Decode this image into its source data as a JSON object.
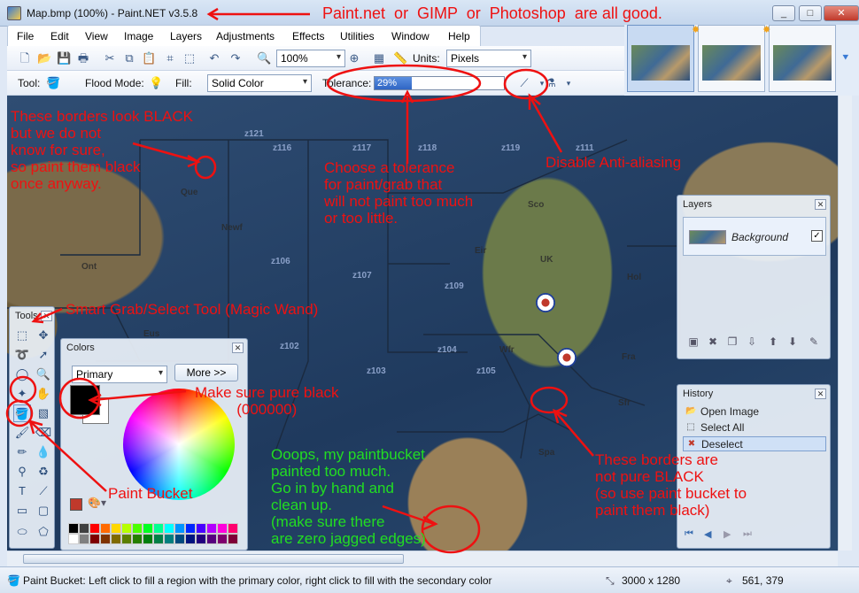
{
  "window": {
    "title": "Map.bmp (100%) - Paint.NET v3.5.8",
    "minimize": "_",
    "maximize": "□",
    "close": "✕"
  },
  "menu": [
    "File",
    "Edit",
    "View",
    "Image",
    "Layers",
    "Adjustments",
    "Effects",
    "Utilities",
    "Window",
    "Help"
  ],
  "toolbar": {
    "zoom_value": "100%",
    "units_label": "Units:",
    "units_value": "Pixels",
    "tool_label": "Tool:",
    "flood_mode_label": "Flood Mode:",
    "fill_label": "Fill:",
    "fill_value": "Solid Color",
    "tolerance_label": "Tolerance:",
    "tolerance_value": "29%",
    "tolerance_fraction": 0.29
  },
  "map": {
    "zones": [
      "z121",
      "z116",
      "z117",
      "z118",
      "z119",
      "z111",
      "z106",
      "z107",
      "z109",
      "z102",
      "z103",
      "z104",
      "z105"
    ],
    "regions": [
      "Que",
      "Newf",
      "Ont",
      "Sco",
      "Eir",
      "UK",
      "Hol",
      "Wfr",
      "Fra",
      "Sfr",
      "Spa",
      "Eus"
    ]
  },
  "annotations": {
    "app_note": "Paint.net  or  GIMP  or  Photoshop  are all good.",
    "borders_black": "These borders look BLACK\nbut we do not\nknow for sure,\nso paint them black\nonce anyway.",
    "tolerance_note": "Choose a tolerance\nfor paint/grab that\nwill not paint too much\nor too little.",
    "antialias_note": "Disable Anti-aliasing",
    "magic_wand_note": "Smart Grab/Select Tool (Magic Wand)",
    "pure_black_note": "Make sure pure black\n          (000000)",
    "paint_bucket_note": "Paint Bucket",
    "oops_note": "Ooops, my paintbucket\npainted too much.\nGo in by hand and\nclean up.\n(make sure there\nare zero jagged edges)",
    "not_black_note": "These borders are\nnot pure BLACK\n(so use paint bucket to\npaint them black)"
  },
  "tools_panel": {
    "title": "Tools"
  },
  "colors_panel": {
    "title": "Colors",
    "mode": "Primary",
    "more_button": "More >>",
    "primary_color": "#000000",
    "secondary_color": "#FFFFFF",
    "palette": [
      "#000000",
      "#404040",
      "#ff0000",
      "#ff6a00",
      "#ffd800",
      "#b6ff00",
      "#4cff00",
      "#00ff21",
      "#00ff90",
      "#00ffff",
      "#0094ff",
      "#0026ff",
      "#4800ff",
      "#b200ff",
      "#ff00dc",
      "#ff006e",
      "#ffffff",
      "#808080",
      "#7f0000",
      "#7f3300",
      "#7f6a00",
      "#5b7f00",
      "#267f00",
      "#007f0e",
      "#007f46",
      "#007f7f",
      "#004a7f",
      "#00137f",
      "#21007f",
      "#57007f",
      "#7f006e",
      "#7f0037"
    ]
  },
  "layers_panel": {
    "title": "Layers",
    "layer_name": "Background",
    "layer_visible_mark": "✓"
  },
  "history_panel": {
    "title": "History",
    "items": [
      "Open Image",
      "Select All",
      "Deselect"
    ]
  },
  "status": {
    "hint": "Paint Bucket: Left click to fill a region with the primary color, right click to fill with the secondary color",
    "image_size": "3000 x 1280",
    "cursor_pos": "561, 379"
  },
  "icons": {
    "new": "new-file-icon",
    "open": "open-icon",
    "save": "save-icon",
    "print": "print-icon",
    "cut": "cut-icon",
    "copy": "copy-icon",
    "paste": "paste-icon",
    "undo": "undo-icon",
    "redo": "redo-icon",
    "zoom_out": "zoom-out-icon",
    "zoom_in": "zoom-in-icon",
    "grid": "grid-icon",
    "ruler": "ruler-icon",
    "paint_bucket": "paint-bucket-icon",
    "flood_mode": "bulb-icon",
    "antialias": "antialias-icon",
    "blend": "flask-icon"
  },
  "colors": {
    "annotation_red": "#ee1111",
    "annotation_green": "#22dd22",
    "accent": "#2f66c4"
  }
}
